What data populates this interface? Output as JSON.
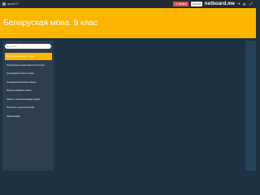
{
  "topbar": {
    "username": "жоха777",
    "red_button_label": "Выйти",
    "counter_label": "0 0 0",
    "brand": "netboard.me"
  },
  "header": {
    "title": "Беларуская мова. 9 клас"
  },
  "sidebar": {
    "search_placeholder": "Search",
    "items": [
      {
        "label": "Беларуская мова. 9 клас",
        "active": true
      },
      {
        "label": "Паўтарэнне вывучанага ў 8 класе",
        "active": false
      },
      {
        "label": "Складназлучаныя сказы",
        "active": false
      },
      {
        "label": "Складаназалежныя сказы",
        "active": false
      },
      {
        "label": "Бяззлучнікавыя сказы",
        "active": false
      },
      {
        "label": "Сказы з рознымі відамі сувязі",
        "active": false
      },
      {
        "label": "Простая і ускосная мова",
        "active": false
      },
      {
        "label": "Арфаграфія",
        "active": false
      }
    ]
  },
  "colors": {
    "accent": "#fbb600",
    "topbar_bg": "#232b35",
    "sidebar_bg": "#2c3e50",
    "content_bg": "#1d3344",
    "red": "#d9534f"
  }
}
